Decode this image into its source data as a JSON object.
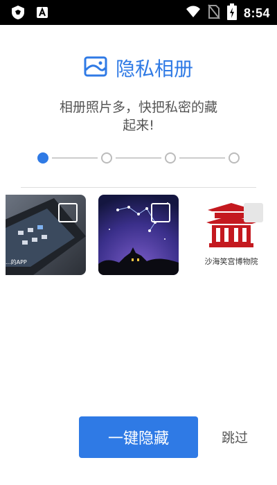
{
  "status_bar": {
    "time": "8:54"
  },
  "header": {
    "title": "隐私相册",
    "icon": "album-image-icon"
  },
  "subtitle": "相册照片多，快把私密的藏起来!",
  "steps": {
    "total": 4,
    "active_index": 0
  },
  "photos": [
    {
      "caption": "...的APP",
      "checked": false
    },
    {
      "caption": "",
      "checked": false
    },
    {
      "caption": "沙海笑宫博物院",
      "checked": false
    }
  ],
  "actions": {
    "primary_label": "一键隐藏",
    "skip_label": "跳过"
  },
  "colors": {
    "accent": "#2f7ae5",
    "status_bar": "#000000",
    "text": "#555555"
  }
}
